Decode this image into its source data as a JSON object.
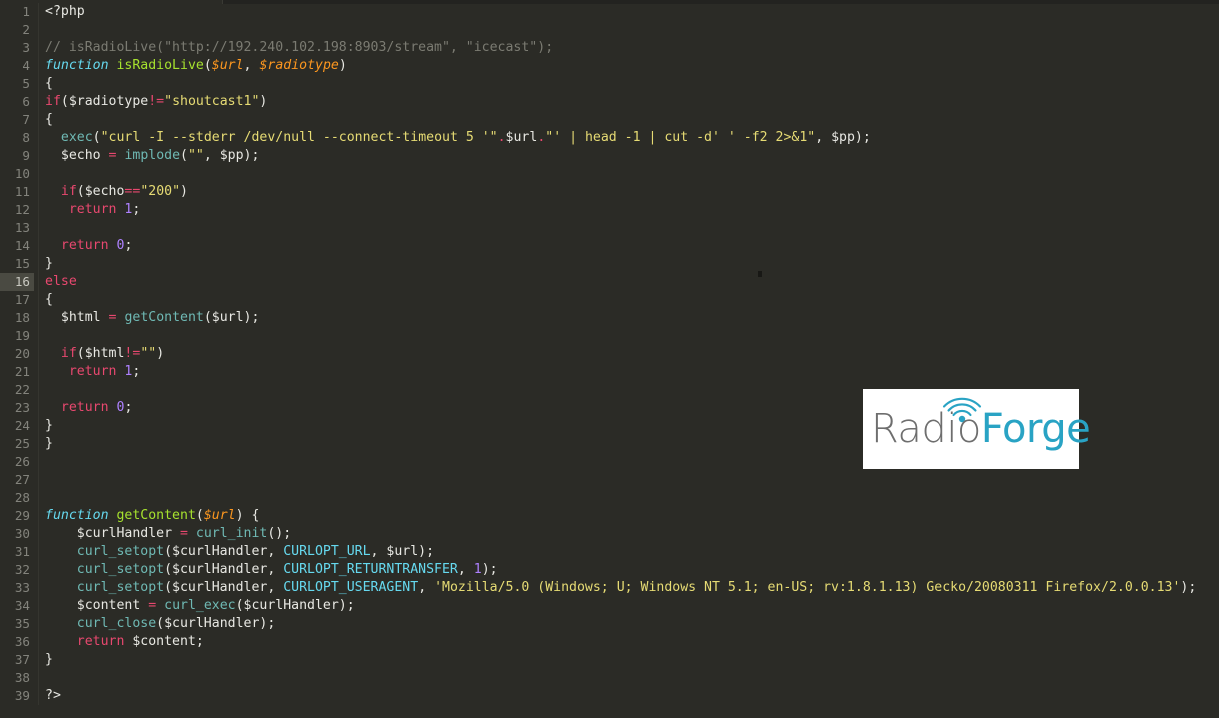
{
  "editor": {
    "theme_background": "#2b2b26",
    "gutter_color": "#83837c",
    "active_line_number": 16,
    "language": "PHP",
    "total_lines": 39
  },
  "logo": {
    "name": "RadioForge",
    "part_one": "Radio",
    "part_two": "Forge",
    "color_one": "#6e6e6e",
    "color_two": "#29a3c4",
    "background": "#ffffff",
    "icon": "radio-waves-icon"
  },
  "code": {
    "lines": [
      {
        "n": "1",
        "tokens": [
          {
            "t": "punct",
            "s": "<?php"
          }
        ]
      },
      {
        "n": "2",
        "tokens": []
      },
      {
        "n": "3",
        "tokens": [
          {
            "t": "comment",
            "s": "// isRadioLive(\"http://192.240.102.198:8903/stream\", \"icecast\");"
          }
        ]
      },
      {
        "n": "4",
        "tokens": [
          {
            "t": "kw2",
            "s": "function"
          },
          {
            "t": "default",
            "s": " "
          },
          {
            "t": "func",
            "s": "isRadioLive"
          },
          {
            "t": "punct",
            "s": "("
          },
          {
            "t": "var",
            "s": "$url"
          },
          {
            "t": "punct",
            "s": ", "
          },
          {
            "t": "var",
            "s": "$radiotype"
          },
          {
            "t": "punct",
            "s": ")"
          }
        ]
      },
      {
        "n": "5",
        "tokens": [
          {
            "t": "punct",
            "s": "{"
          }
        ]
      },
      {
        "n": "6",
        "tokens": [
          {
            "t": "keyword",
            "s": "if"
          },
          {
            "t": "punct",
            "s": "($radiotype"
          },
          {
            "t": "op",
            "s": "!="
          },
          {
            "t": "string",
            "s": "\"shoutcast1\""
          },
          {
            "t": "punct",
            "s": ")"
          }
        ]
      },
      {
        "n": "7",
        "tokens": [
          {
            "t": "punct",
            "s": "{"
          }
        ]
      },
      {
        "n": "8",
        "tokens": [
          {
            "t": "default",
            "s": "  "
          },
          {
            "t": "call",
            "s": "exec"
          },
          {
            "t": "punct",
            "s": "("
          },
          {
            "t": "string",
            "s": "\"curl -I --stderr /dev/null --connect-timeout 5 '\""
          },
          {
            "t": "op",
            "s": "."
          },
          {
            "t": "default",
            "s": "$url"
          },
          {
            "t": "op",
            "s": "."
          },
          {
            "t": "string",
            "s": "\"' | head -1 | cut -d' ' -f2 2>&1\""
          },
          {
            "t": "punct",
            "s": ", $pp);"
          }
        ]
      },
      {
        "n": "9",
        "tokens": [
          {
            "t": "default",
            "s": "  $echo "
          },
          {
            "t": "op",
            "s": "="
          },
          {
            "t": "default",
            "s": " "
          },
          {
            "t": "call",
            "s": "implode"
          },
          {
            "t": "punct",
            "s": "("
          },
          {
            "t": "string",
            "s": "\"\""
          },
          {
            "t": "punct",
            "s": ", $pp);"
          }
        ]
      },
      {
        "n": "10",
        "tokens": []
      },
      {
        "n": "11",
        "tokens": [
          {
            "t": "default",
            "s": "  "
          },
          {
            "t": "keyword",
            "s": "if"
          },
          {
            "t": "punct",
            "s": "($echo"
          },
          {
            "t": "op",
            "s": "=="
          },
          {
            "t": "string",
            "s": "\"200\""
          },
          {
            "t": "punct",
            "s": ")"
          }
        ]
      },
      {
        "n": "12",
        "tokens": [
          {
            "t": "default",
            "s": "   "
          },
          {
            "t": "keyword",
            "s": "return"
          },
          {
            "t": "default",
            "s": " "
          },
          {
            "t": "number",
            "s": "1"
          },
          {
            "t": "punct",
            "s": ";"
          }
        ]
      },
      {
        "n": "13",
        "tokens": []
      },
      {
        "n": "14",
        "tokens": [
          {
            "t": "default",
            "s": "  "
          },
          {
            "t": "keyword",
            "s": "return"
          },
          {
            "t": "default",
            "s": " "
          },
          {
            "t": "number",
            "s": "0"
          },
          {
            "t": "punct",
            "s": ";"
          }
        ]
      },
      {
        "n": "15",
        "tokens": [
          {
            "t": "punct",
            "s": "}"
          }
        ]
      },
      {
        "n": "16",
        "tokens": [
          {
            "t": "keyword",
            "s": "else"
          }
        ],
        "active": true
      },
      {
        "n": "17",
        "tokens": [
          {
            "t": "punct",
            "s": "{"
          }
        ]
      },
      {
        "n": "18",
        "tokens": [
          {
            "t": "default",
            "s": "  $html "
          },
          {
            "t": "op",
            "s": "="
          },
          {
            "t": "default",
            "s": " "
          },
          {
            "t": "call",
            "s": "getContent"
          },
          {
            "t": "punct",
            "s": "($url);"
          }
        ]
      },
      {
        "n": "19",
        "tokens": []
      },
      {
        "n": "20",
        "tokens": [
          {
            "t": "default",
            "s": "  "
          },
          {
            "t": "keyword",
            "s": "if"
          },
          {
            "t": "punct",
            "s": "($html"
          },
          {
            "t": "op",
            "s": "!="
          },
          {
            "t": "string",
            "s": "\"\""
          },
          {
            "t": "punct",
            "s": ")"
          }
        ]
      },
      {
        "n": "21",
        "tokens": [
          {
            "t": "default",
            "s": "   "
          },
          {
            "t": "keyword",
            "s": "return"
          },
          {
            "t": "default",
            "s": " "
          },
          {
            "t": "number",
            "s": "1"
          },
          {
            "t": "punct",
            "s": ";"
          }
        ]
      },
      {
        "n": "22",
        "tokens": []
      },
      {
        "n": "23",
        "tokens": [
          {
            "t": "default",
            "s": "  "
          },
          {
            "t": "keyword",
            "s": "return"
          },
          {
            "t": "default",
            "s": " "
          },
          {
            "t": "number",
            "s": "0"
          },
          {
            "t": "punct",
            "s": ";"
          }
        ]
      },
      {
        "n": "24",
        "tokens": [
          {
            "t": "punct",
            "s": "}"
          }
        ]
      },
      {
        "n": "25",
        "tokens": [
          {
            "t": "punct",
            "s": "}"
          }
        ]
      },
      {
        "n": "26",
        "tokens": []
      },
      {
        "n": "27",
        "tokens": []
      },
      {
        "n": "28",
        "tokens": []
      },
      {
        "n": "29",
        "tokens": [
          {
            "t": "kw2",
            "s": "function"
          },
          {
            "t": "default",
            "s": " "
          },
          {
            "t": "func",
            "s": "getContent"
          },
          {
            "t": "punct",
            "s": "("
          },
          {
            "t": "var",
            "s": "$url"
          },
          {
            "t": "punct",
            "s": ") {"
          }
        ]
      },
      {
        "n": "30",
        "tokens": [
          {
            "t": "default",
            "s": "    $curlHandler "
          },
          {
            "t": "op",
            "s": "="
          },
          {
            "t": "default",
            "s": " "
          },
          {
            "t": "call",
            "s": "curl_init"
          },
          {
            "t": "punct",
            "s": "();"
          }
        ]
      },
      {
        "n": "31",
        "tokens": [
          {
            "t": "default",
            "s": "    "
          },
          {
            "t": "call",
            "s": "curl_setopt"
          },
          {
            "t": "punct",
            "s": "($curlHandler, "
          },
          {
            "t": "const",
            "s": "CURLOPT_URL"
          },
          {
            "t": "punct",
            "s": ", $url);"
          }
        ]
      },
      {
        "n": "32",
        "tokens": [
          {
            "t": "default",
            "s": "    "
          },
          {
            "t": "call",
            "s": "curl_setopt"
          },
          {
            "t": "punct",
            "s": "($curlHandler, "
          },
          {
            "t": "const",
            "s": "CURLOPT_RETURNTRANSFER"
          },
          {
            "t": "punct",
            "s": ", "
          },
          {
            "t": "number",
            "s": "1"
          },
          {
            "t": "punct",
            "s": ");"
          }
        ]
      },
      {
        "n": "33",
        "tokens": [
          {
            "t": "default",
            "s": "    "
          },
          {
            "t": "call",
            "s": "curl_setopt"
          },
          {
            "t": "punct",
            "s": "($curlHandler, "
          },
          {
            "t": "const",
            "s": "CURLOPT_USERAGENT"
          },
          {
            "t": "punct",
            "s": ", "
          },
          {
            "t": "string",
            "s": "'Mozilla/5.0 (Windows; U; Windows NT 5.1; en-US; rv:1.8.1.13) Gecko/20080311 Firefox/2.0.0.13'"
          },
          {
            "t": "punct",
            "s": ");"
          }
        ]
      },
      {
        "n": "34",
        "tokens": [
          {
            "t": "default",
            "s": "    $content "
          },
          {
            "t": "op",
            "s": "="
          },
          {
            "t": "default",
            "s": " "
          },
          {
            "t": "call",
            "s": "curl_exec"
          },
          {
            "t": "punct",
            "s": "($curlHandler);"
          }
        ]
      },
      {
        "n": "35",
        "tokens": [
          {
            "t": "default",
            "s": "    "
          },
          {
            "t": "call",
            "s": "curl_close"
          },
          {
            "t": "punct",
            "s": "($curlHandler);"
          }
        ]
      },
      {
        "n": "36",
        "tokens": [
          {
            "t": "default",
            "s": "    "
          },
          {
            "t": "keyword",
            "s": "return"
          },
          {
            "t": "default",
            "s": " $content;"
          }
        ]
      },
      {
        "n": "37",
        "tokens": [
          {
            "t": "punct",
            "s": "}"
          }
        ]
      },
      {
        "n": "38",
        "tokens": []
      },
      {
        "n": "39",
        "tokens": [
          {
            "t": "punct",
            "s": "?>"
          }
        ]
      }
    ]
  }
}
